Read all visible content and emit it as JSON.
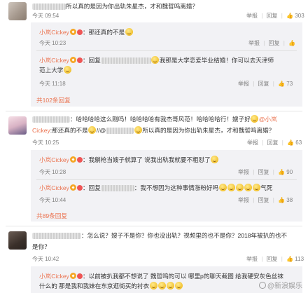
{
  "comments": [
    {
      "text": "所以真的是因为你出轨朱星杰，才和魏哲鸣离婚？",
      "time": "今天 09:54",
      "likes": "303",
      "replies": [
        {
          "user": "小岚Cickey",
          "text": "：那还真的不是",
          "time": "今天 10:23",
          "likes": ""
        },
        {
          "user": "小岚Cickey",
          "reply_to": "回复",
          "text_1": "我那是大学恋爱毕业结婚！你可以去天津师",
          "text_2": "范上大学",
          "time": "今天 11:18",
          "likes": "73"
        }
      ],
      "more": "共102条回复"
    },
    {
      "text_1": "：哈哈哈哈这么刚吗！哈哈哈哈有我杰哥风范！哈哈哈哈行！嫂子好",
      "mention_1": "@小岚",
      "mention_2": "Cickey",
      "text_2": ":那还真的不是",
      "text_3": "所以真的是因为你出轨朱星杰，才和魏哲鸣离婚？",
      "time": "今天 10:25",
      "likes": "63",
      "replies": [
        {
          "user": "小岚Cickey",
          "text": "：我躺枪当嫂子就算了 说我出轨我就要不粗怼了",
          "time": "今天 10:28",
          "likes": "90"
        },
        {
          "user": "小岚Cickey",
          "text": "：我不想因为这种事情涨粉好吗",
          "text_2": "气死",
          "time": "今天 10:44",
          "likes": "38"
        }
      ],
      "more": "共89条回复"
    },
    {
      "text_1": "：怎么说？嫂子不是你？你也没出轨？视频里的也不是你？2018年被扒的也不",
      "text_2": "是你？",
      "time": "今天 10:42",
      "likes": "113",
      "replies": [
        {
          "user": "小岚Cickey",
          "text_1": "：以前被扒我都不想说了 魏哲鸣的可以 哪里p的聊天截图 给我硬安灰色丝袜",
          "text_2": "什么的 那是我和我妹在东京逛街买的衬衣"
        }
      ]
    }
  ],
  "actions": {
    "report": "举报",
    "reply": "回复"
  },
  "watermark": "@新浪娱乐"
}
